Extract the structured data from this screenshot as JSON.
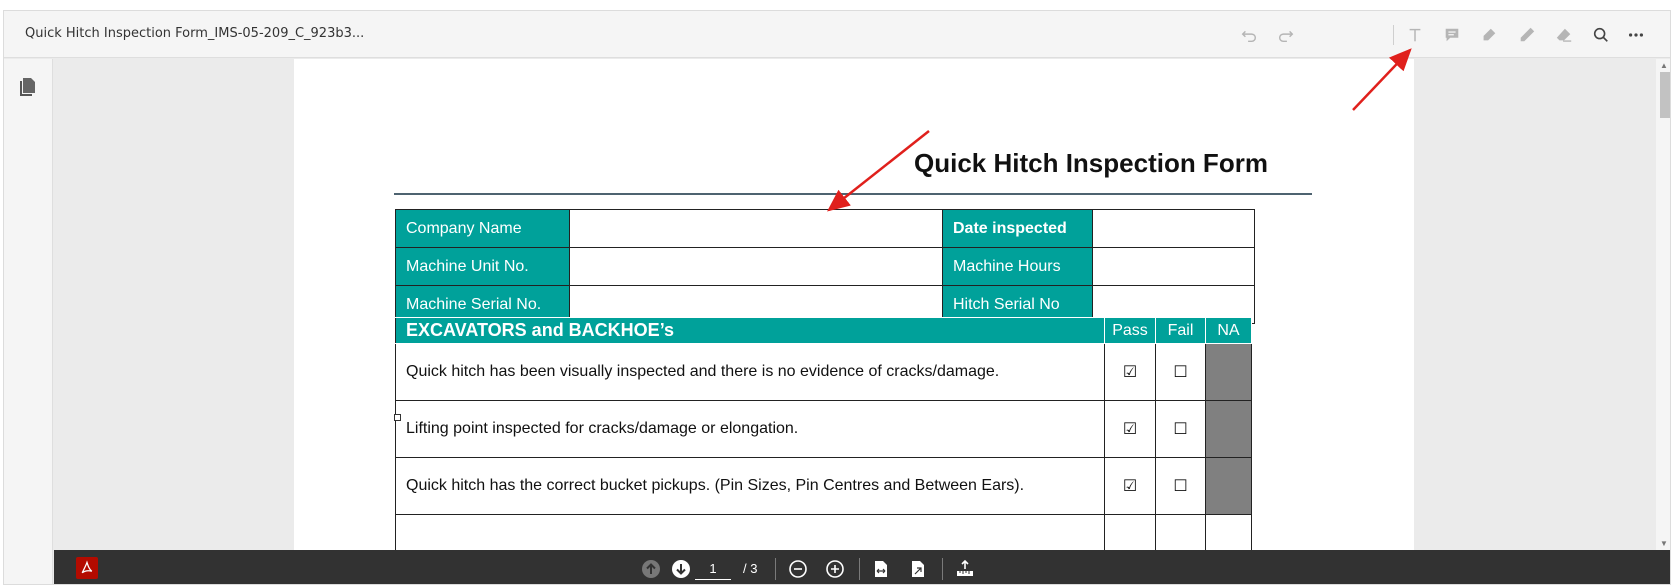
{
  "document": {
    "title": "Quick Hitch Inspection Form_IMS-05-209_C_923b3..."
  },
  "toolbar": {
    "tools": [
      "undo-icon",
      "redo-icon",
      "add-text-icon",
      "comment-icon",
      "highlight-icon",
      "draw-icon",
      "eraser-icon",
      "search-icon",
      "more-icon"
    ]
  },
  "form": {
    "heading": "Quick Hitch Inspection Form",
    "info_rows": [
      {
        "label": "Company Name",
        "value": "",
        "label2": "Date inspected",
        "value2": ""
      },
      {
        "label": "Machine Unit No.",
        "value": "",
        "label2": "Machine Hours",
        "value2": ""
      },
      {
        "label": "Machine Serial No.",
        "value": "",
        "label2": "Hitch Serial No",
        "value2": ""
      }
    ],
    "checklist": {
      "section": "EXCAVATORS and BACKHOE’s",
      "col_pass": "Pass",
      "col_fail": "Fail",
      "col_na": "NA",
      "items": [
        {
          "text": "Quick hitch has been visually inspected and there is no evidence of cracks/damage.",
          "pass": "☑",
          "fail": "☐"
        },
        {
          "text": "Lifting point inspected for cracks/damage or elongation.",
          "pass": "☑",
          "fail": "☐"
        },
        {
          "text": "Quick hitch has the correct bucket pickups.  (Pin Sizes, Pin Centres and Between Ears).",
          "pass": "☑",
          "fail": "☐"
        }
      ]
    }
  },
  "pagination": {
    "current_page": "1",
    "total": "/ 3"
  },
  "colors": {
    "accent": "#00a19a",
    "na_fill": "#808080",
    "annotation_arrow": "#e0201c",
    "bottom_bar": "#323232",
    "acrobat_red": "#b30b00"
  }
}
